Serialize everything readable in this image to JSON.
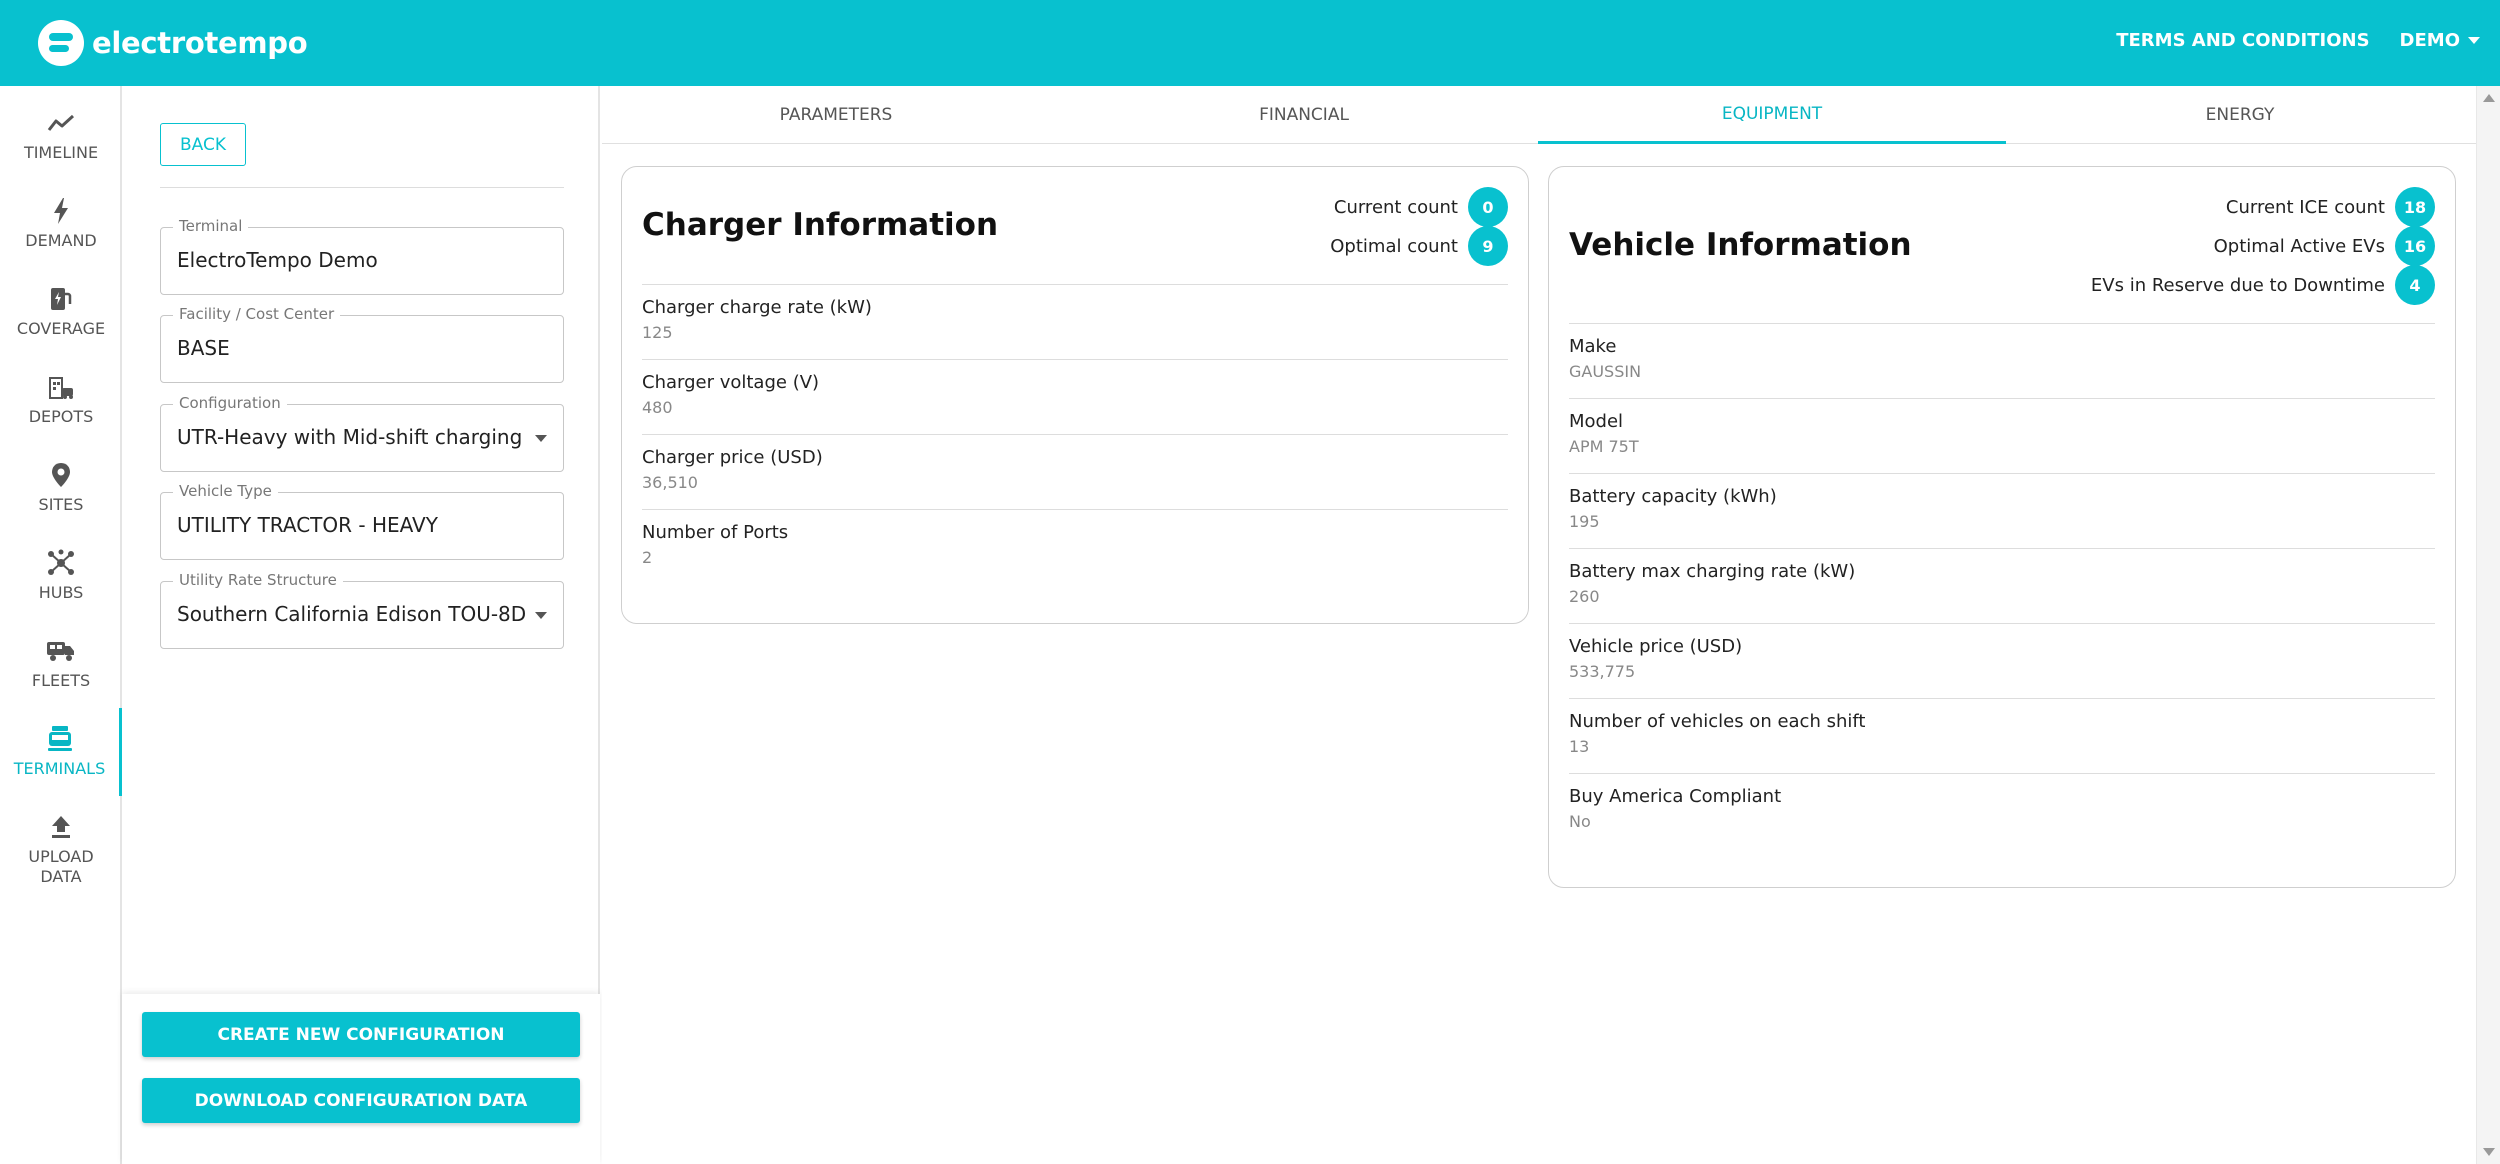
{
  "app": {
    "brand": "electrotempo",
    "accent": "#08c1cf"
  },
  "header": {
    "terms_label": "TERMS AND CONDITIONS",
    "user_label": "DEMO"
  },
  "nav": {
    "items": [
      {
        "label": "TIMELINE",
        "icon": "trend-line-icon"
      },
      {
        "label": "DEMAND",
        "icon": "lightning-icon"
      },
      {
        "label": "COVERAGE",
        "icon": "ev-station-icon"
      },
      {
        "label": "DEPOTS",
        "icon": "depot-building-icon"
      },
      {
        "label": "SITES",
        "icon": "map-pin-icon"
      },
      {
        "label": "HUBS",
        "icon": "hub-network-icon"
      },
      {
        "label": "FLEETS",
        "icon": "truck-icon"
      },
      {
        "label": "TERMINALS",
        "icon": "terminal-vehicle-icon",
        "active": true
      },
      {
        "label_line1": "UPLOAD",
        "label_line2": "DATA",
        "icon": "upload-icon"
      }
    ]
  },
  "settings": {
    "back_label": "BACK",
    "fields": [
      {
        "label": "Terminal",
        "value": "ElectroTempo Demo",
        "dropdown": false
      },
      {
        "label": "Facility / Cost Center",
        "value": "BASE",
        "dropdown": false
      },
      {
        "label": "Configuration",
        "value": "UTR-Heavy with Mid-shift charging",
        "dropdown": true
      },
      {
        "label": "Vehicle Type",
        "value": "UTILITY TRACTOR - HEAVY",
        "dropdown": false
      },
      {
        "label": "Utility Rate Structure",
        "value": "Southern California Edison TOU-8D",
        "dropdown": true
      }
    ],
    "create_label": "CREATE NEW CONFIGURATION",
    "download_label": "DOWNLOAD CONFIGURATION DATA"
  },
  "tabs": [
    {
      "label": "PARAMETERS"
    },
    {
      "label": "FINANCIAL"
    },
    {
      "label": "EQUIPMENT",
      "active": true
    },
    {
      "label": "ENERGY"
    }
  ],
  "charger": {
    "title": "Charger Information",
    "counts": [
      {
        "label": "Current count",
        "value": "0"
      },
      {
        "label": "Optimal count",
        "value": "9"
      }
    ],
    "props": [
      {
        "label": "Charger charge rate (kW)",
        "value": "125"
      },
      {
        "label": "Charger voltage (V)",
        "value": "480"
      },
      {
        "label": "Charger price (USD)",
        "value": "36,510"
      },
      {
        "label": "Number of Ports",
        "value": "2"
      }
    ]
  },
  "vehicle": {
    "title": "Vehicle Information",
    "counts": [
      {
        "label": "Current ICE count",
        "value": "18"
      },
      {
        "label": "Optimal Active EVs",
        "value": "16"
      },
      {
        "label": "EVs in Reserve due to Downtime",
        "value": "4"
      }
    ],
    "props": [
      {
        "label": "Make",
        "value": "GAUSSIN"
      },
      {
        "label": "Model",
        "value": "APM 75T"
      },
      {
        "label": "Battery capacity (kWh)",
        "value": "195"
      },
      {
        "label": "Battery max charging rate (kW)",
        "value": "260"
      },
      {
        "label": "Vehicle price (USD)",
        "value": "533,775"
      },
      {
        "label": "Number of vehicles on each shift",
        "value": "13"
      },
      {
        "label": "Buy America Compliant",
        "value": "No"
      }
    ]
  }
}
